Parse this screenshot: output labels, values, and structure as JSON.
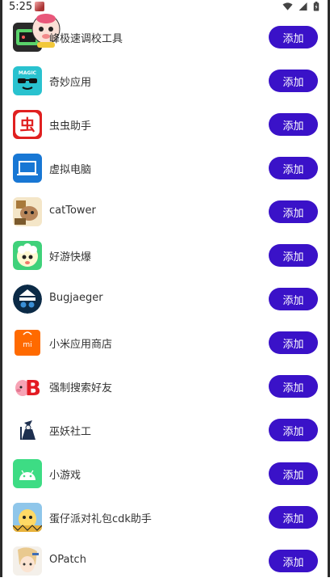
{
  "status_bar": {
    "time": "5:25"
  },
  "items": [
    {
      "name": "峰极速调校工具",
      "button": "添加",
      "icon": "rocket-tool-icon"
    },
    {
      "name": "奇妙应用",
      "button": "添加",
      "icon": "magic-icon",
      "icon_text": "MAGIC"
    },
    {
      "name": "虫虫助手",
      "button": "添加",
      "icon": "bug-helper-icon",
      "icon_text": "虫"
    },
    {
      "name": "虚拟电脑",
      "button": "添加",
      "icon": "laptop-icon"
    },
    {
      "name": "catTower",
      "button": "添加",
      "icon": "cat-tower-icon"
    },
    {
      "name": "好游快爆",
      "button": "添加",
      "icon": "haoyou-icon"
    },
    {
      "name": "Bugjaeger",
      "button": "添加",
      "icon": "bugjaeger-icon"
    },
    {
      "name": "小米应用商店",
      "button": "添加",
      "icon": "mi-store-icon",
      "icon_text": "mi"
    },
    {
      "name": "强制搜索好友",
      "button": "添加",
      "icon": "pig-b-icon",
      "icon_text": "B"
    },
    {
      "name": "巫妖社工",
      "button": "添加",
      "icon": "lich-icon"
    },
    {
      "name": "小游戏",
      "button": "添加",
      "icon": "android-icon"
    },
    {
      "name": "蛋仔派对礼包cdk助手",
      "button": "添加",
      "icon": "eggy-party-icon"
    },
    {
      "name": "OPatch",
      "button": "添加",
      "icon": "opatch-icon"
    }
  ],
  "colors": {
    "button": "#3a12c8",
    "magic_bg": "#29c2cf",
    "bug_red": "#e02020",
    "laptop_bg": "#1877d4",
    "mi_orange": "#ff6a00",
    "android_green": "#3ddc84"
  }
}
